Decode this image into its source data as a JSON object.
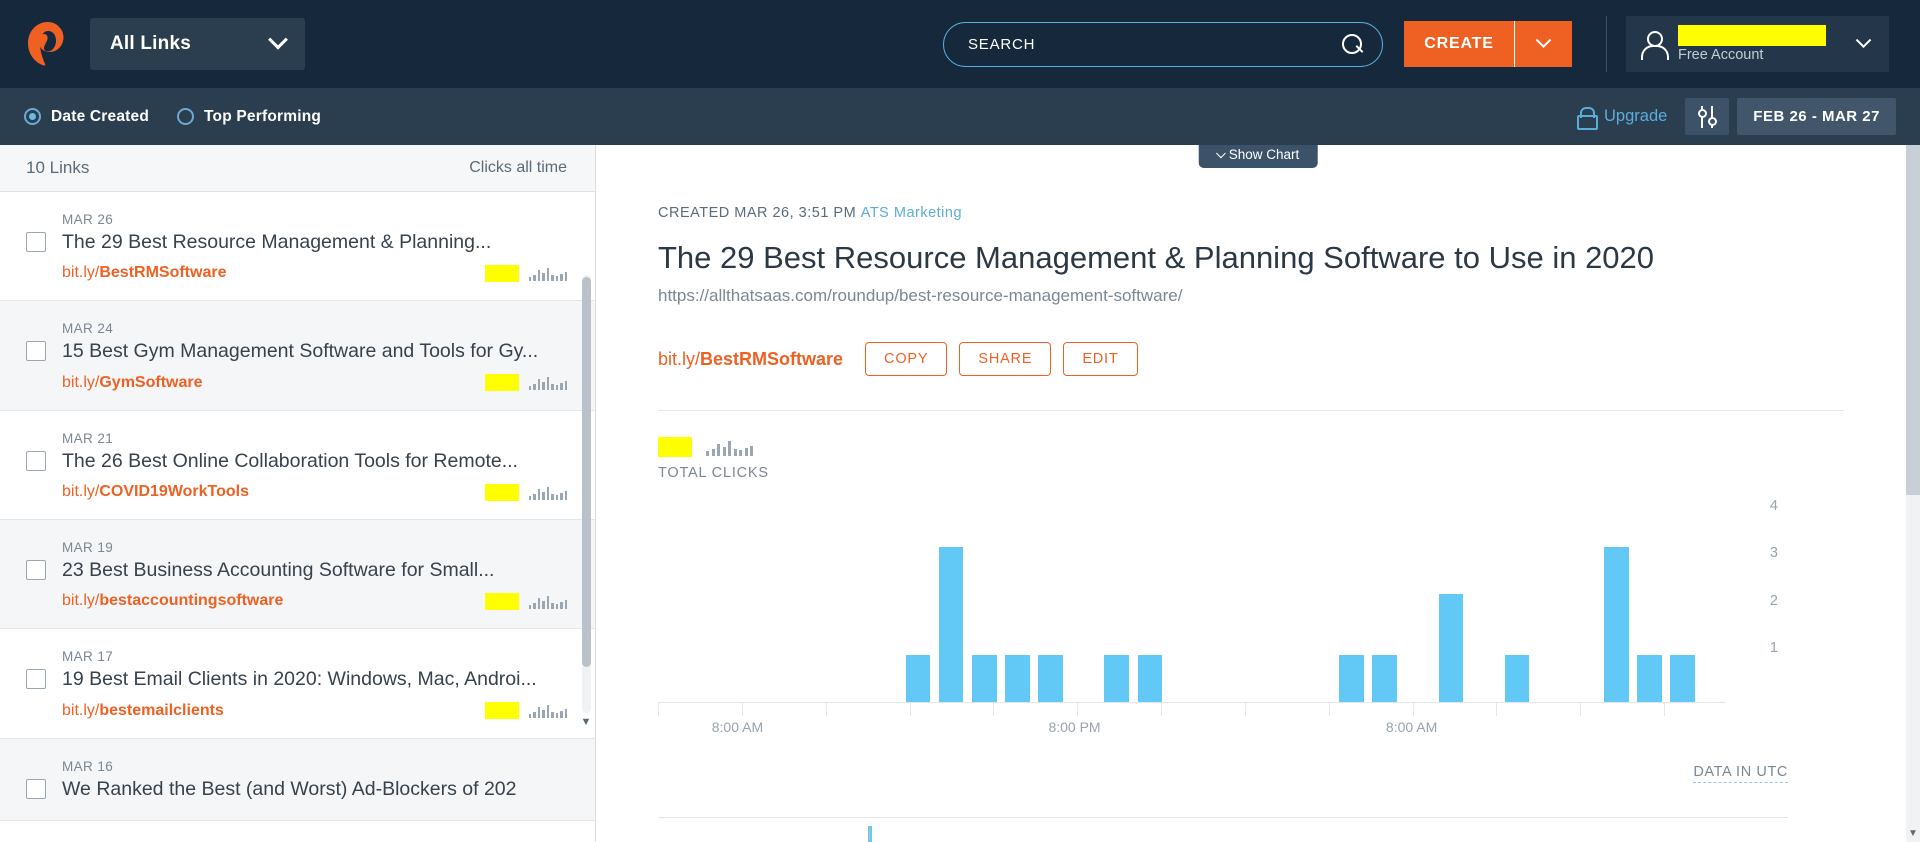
{
  "topnav": {
    "logo_name": "bitly-logo",
    "all_links_label": "All Links",
    "search_placeholder": "SEARCH",
    "search_value": "",
    "create_label": "CREATE",
    "account_name_redacted": "",
    "account_type": "Free Account"
  },
  "subbar": {
    "sort_options": [
      {
        "label": "Date Created",
        "selected": true
      },
      {
        "label": "Top Performing",
        "selected": false
      }
    ],
    "upgrade_label": "Upgrade",
    "date_range": "FEB 26 - MAR 27"
  },
  "sidebar": {
    "count_label": "10 Links",
    "clicks_label": "Clicks all time",
    "links": [
      {
        "date": "MAR 26",
        "title": "The 29 Best Resource Management & Planning...",
        "short_prefix": "bit.ly/",
        "short_slug": "BestRMSoftware"
      },
      {
        "date": "MAR 24",
        "title": "15 Best Gym Management Software and Tools for Gy...",
        "short_prefix": "bit.ly/",
        "short_slug": "GymSoftware"
      },
      {
        "date": "MAR 21",
        "title": "The 26 Best Online Collaboration Tools for Remote...",
        "short_prefix": "bit.ly/",
        "short_slug": "COVID19WorkTools"
      },
      {
        "date": "MAR 19",
        "title": "23 Best Business Accounting Software for Small...",
        "short_prefix": "bit.ly/",
        "short_slug": "bestaccountingsoftware"
      },
      {
        "date": "MAR 17",
        "title": "19 Best Email Clients in 2020: Windows, Mac, Androi...",
        "short_prefix": "bit.ly/",
        "short_slug": "bestemailclients"
      },
      {
        "date": "MAR 16",
        "title": "We Ranked the Best (and Worst) Ad-Blockers of 202",
        "short_prefix": "",
        "short_slug": ""
      }
    ]
  },
  "main": {
    "show_chart_label": "Show Chart",
    "created_label": "CREATED MAR 26, 3:51 PM",
    "campaign": "ATS Marketing",
    "title": "The 29 Best Resource Management & Planning Software to Use in 2020",
    "long_url": "https://allthatsaas.com/roundup/best-resource-management-software/",
    "short_prefix": "bit.ly/",
    "short_slug": "BestRMSoftware",
    "buttons": {
      "copy": "COPY",
      "share": "SHARE",
      "edit": "EDIT"
    },
    "total_clicks_label": "TOTAL CLICKS",
    "total_clicks_value_redacted": "",
    "data_in_utc": "DATA IN UTC"
  },
  "chart_data": {
    "type": "bar",
    "title": "TOTAL CLICKS",
    "xlabel": "",
    "ylabel": "",
    "ylim": [
      0,
      4.4
    ],
    "grid": false,
    "legend": false,
    "yticks": [
      1,
      2,
      3,
      4
    ],
    "xticks": [
      "8:00 AM",
      "8:00 PM",
      "8:00 AM"
    ],
    "xtick_positions_pct": [
      7.4,
      38.8,
      70.2
    ],
    "series": [
      {
        "name": "Clicks",
        "color": "#62c8f5",
        "bars": [
          {
            "x_pct": 23.2,
            "value": 1
          },
          {
            "x_pct": 26.3,
            "value": 3.3
          },
          {
            "x_pct": 29.4,
            "value": 1
          },
          {
            "x_pct": 32.5,
            "value": 1
          },
          {
            "x_pct": 35.6,
            "value": 1
          },
          {
            "x_pct": 41.8,
            "value": 1
          },
          {
            "x_pct": 44.9,
            "value": 1
          },
          {
            "x_pct": 63.8,
            "value": 1
          },
          {
            "x_pct": 66.9,
            "value": 1
          },
          {
            "x_pct": 73.1,
            "value": 2.3
          },
          {
            "x_pct": 79.3,
            "value": 1
          },
          {
            "x_pct": 88.6,
            "value": 3.3
          },
          {
            "x_pct": 91.7,
            "value": 1
          },
          {
            "x_pct": 94.8,
            "value": 1
          }
        ]
      }
    ]
  },
  "sparkline": {
    "sidebar_heights": [
      4,
      6,
      11,
      8,
      13,
      6,
      5,
      7,
      9
    ],
    "main_heights": [
      5,
      7,
      12,
      9,
      15,
      7,
      6,
      8,
      10
    ]
  }
}
